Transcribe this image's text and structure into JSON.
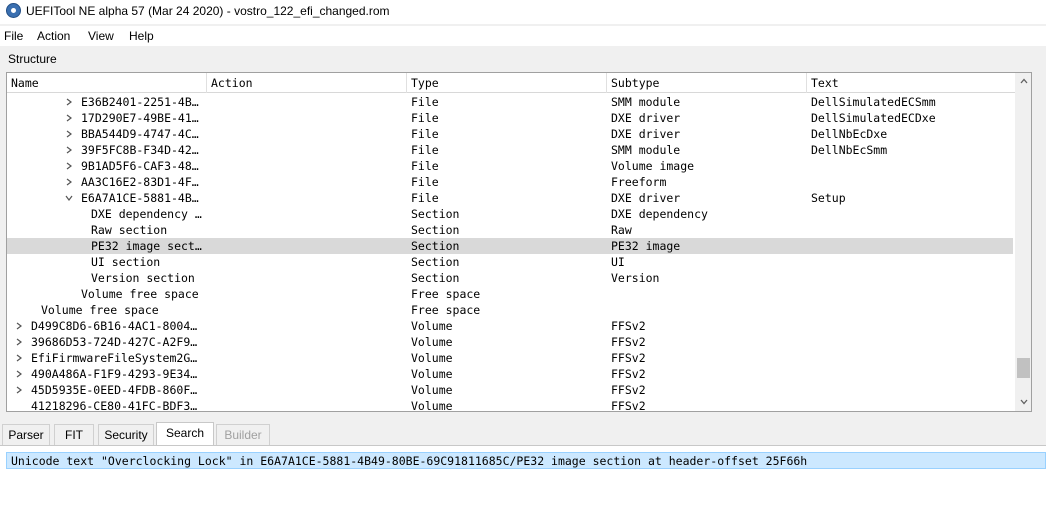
{
  "window": {
    "title": "UEFITool NE alpha 57 (Mar 24 2020) - vostro_122_efi_changed.rom"
  },
  "menu": [
    "File",
    "Action",
    "View",
    "Help"
  ],
  "structure_label": "Structure",
  "columns": [
    "Name",
    "Action",
    "Type",
    "Subtype",
    "Text"
  ],
  "rows": [
    {
      "expander": "collapsed",
      "name": "E36B2401-2251-4B…",
      "action": "",
      "type": "File",
      "subtype": "SMM module",
      "text": "DellSimulatedECSmm"
    },
    {
      "expander": "collapsed",
      "name": "17D290E7-49BE-41…",
      "action": "",
      "type": "File",
      "subtype": "DXE driver",
      "text": "DellSimulatedECDxe"
    },
    {
      "expander": "collapsed",
      "name": "BBA544D9-4747-4C…",
      "action": "",
      "type": "File",
      "subtype": "DXE driver",
      "text": "DellNbEcDxe"
    },
    {
      "expander": "collapsed",
      "name": "39F5FC8B-F34D-42…",
      "action": "",
      "type": "File",
      "subtype": "SMM module",
      "text": "DellNbEcSmm"
    },
    {
      "expander": "collapsed",
      "name": "9B1AD5F6-CAF3-48…",
      "action": "",
      "type": "File",
      "subtype": "Volume image",
      "text": ""
    },
    {
      "expander": "collapsed",
      "name": "AA3C16E2-83D1-4F…",
      "action": "",
      "type": "File",
      "subtype": "Freeform",
      "text": ""
    },
    {
      "expander": "expanded",
      "name": "E6A7A1CE-5881-4B…",
      "action": "",
      "type": "File",
      "subtype": "DXE driver",
      "text": "Setup"
    },
    {
      "expander": "none",
      "name": "DXE dependency …",
      "action": "",
      "type": "Section",
      "subtype": "DXE dependency",
      "text": ""
    },
    {
      "expander": "none",
      "name": "Raw section",
      "action": "",
      "type": "Section",
      "subtype": "Raw",
      "text": ""
    },
    {
      "expander": "none",
      "name": "PE32 image sect…",
      "action": "",
      "type": "Section",
      "subtype": "PE32 image",
      "text": "",
      "selected": true
    },
    {
      "expander": "none",
      "name": "UI section",
      "action": "",
      "type": "Section",
      "subtype": "UI",
      "text": ""
    },
    {
      "expander": "none",
      "name": "Version section",
      "action": "",
      "type": "Section",
      "subtype": "Version",
      "text": ""
    },
    {
      "expander": "none",
      "name": "Volume free space",
      "action": "",
      "type": "Free space",
      "subtype": "",
      "text": ""
    },
    {
      "expander": "none",
      "name": "Volume free space",
      "action": "",
      "type": "Free space",
      "subtype": "",
      "text": ""
    },
    {
      "expander": "collapsed",
      "name": "D499C8D6-6B16-4AC1-8004…",
      "action": "",
      "type": "Volume",
      "subtype": "FFSv2",
      "text": ""
    },
    {
      "expander": "collapsed",
      "name": "39686D53-724D-427C-A2F9…",
      "action": "",
      "type": "Volume",
      "subtype": "FFSv2",
      "text": ""
    },
    {
      "expander": "collapsed",
      "name": "EfiFirmwareFileSystem2G…",
      "action": "",
      "type": "Volume",
      "subtype": "FFSv2",
      "text": ""
    },
    {
      "expander": "collapsed",
      "name": "490A486A-F1F9-4293-9E34…",
      "action": "",
      "type": "Volume",
      "subtype": "FFSv2",
      "text": ""
    },
    {
      "expander": "collapsed",
      "name": "45D5935E-0EED-4FDB-860F…",
      "action": "",
      "type": "Volume",
      "subtype": "FFSv2",
      "text": ""
    },
    {
      "expander": "none",
      "name": "41218296-CE80-41FC-BDF3…",
      "action": "",
      "type": "Volume",
      "subtype": "FFSv2",
      "text": ""
    }
  ],
  "tabs": [
    {
      "label": "Parser",
      "state": "normal"
    },
    {
      "label": "FIT",
      "state": "normal"
    },
    {
      "label": "Security",
      "state": "normal"
    },
    {
      "label": "Search",
      "state": "active"
    },
    {
      "label": "Builder",
      "state": "disabled"
    }
  ],
  "search_results": [
    "Unicode text \"Overclocking Lock\" in E6A7A1CE-5881-4B49-80BE-69C91811685C/PE32 image section at header-offset 25F66h"
  ],
  "colors": {
    "selection": "#d9d9d9",
    "result_highlight": "#cce8ff",
    "result_border": "#99d1ff",
    "app_icon": "#3a6fb0"
  }
}
